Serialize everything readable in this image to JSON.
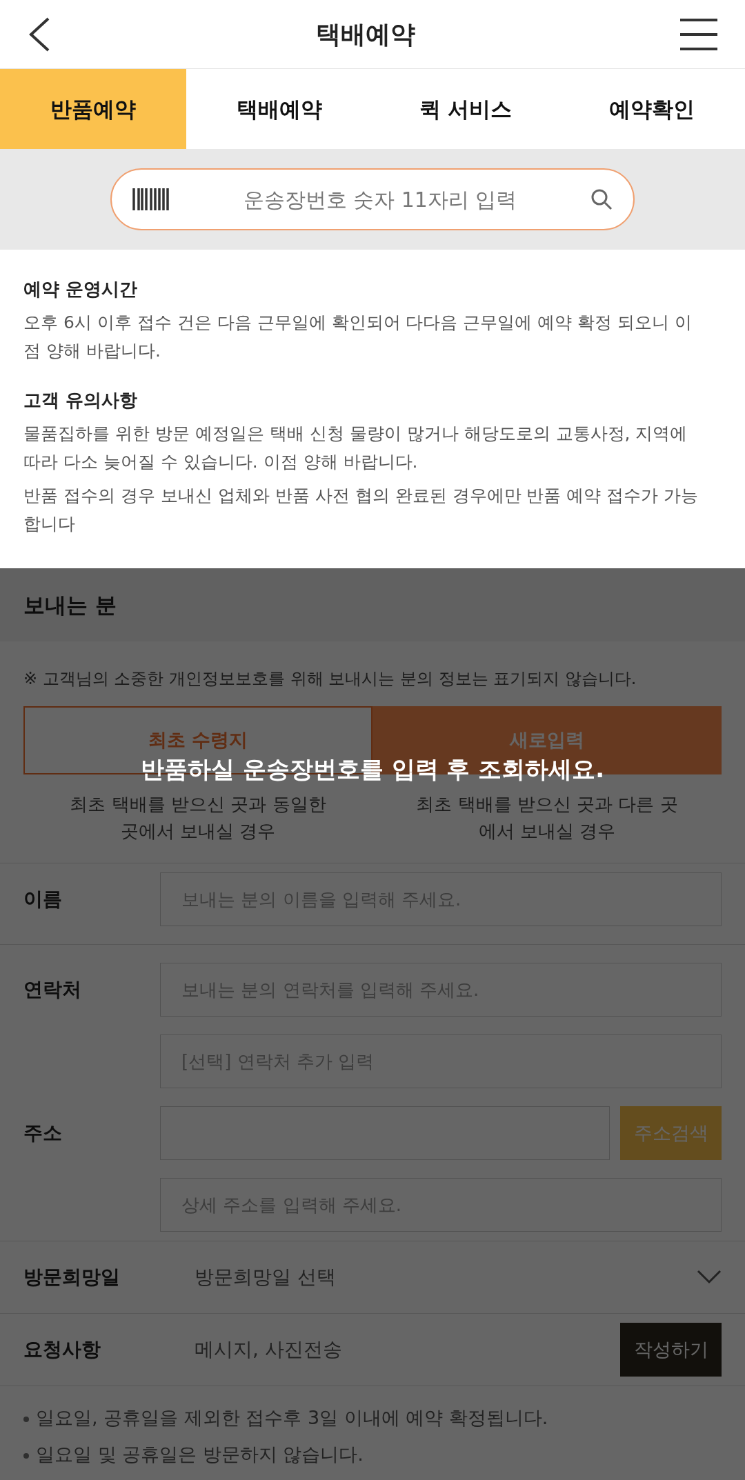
{
  "header": {
    "title": "택배예약"
  },
  "tabs": [
    {
      "label": "반품예약",
      "selected": true
    },
    {
      "label": "택배예약",
      "selected": false
    },
    {
      "label": "퀵 서비스",
      "selected": false
    },
    {
      "label": "예약확인",
      "selected": false
    }
  ],
  "search": {
    "placeholder": "운송장번호 숫자 11자리 입력"
  },
  "info": [
    {
      "title": "예약 운영시간",
      "paragraphs": [
        "오후 6시 이후 접수 건은 다음 근무일에 확인되어 다다음 근무일에 예약 확정 되오니 이점 양해 바랍니다."
      ]
    },
    {
      "title": "고객 유의사항",
      "paragraphs": [
        "물품집하를 위한 방문 예정일은 택배 신청 물량이 많거나 해당도로의 교통사정, 지역에 따라 다소 늦어질 수 있습니다. 이점 양해 바랍니다.",
        "반품 접수의 경우 보내신 업체와 반품 사전 협의 완료된 경우에만 반품 예약 접수가 가능합니다"
      ]
    }
  ],
  "sender": {
    "title": "보내는 분",
    "notice": "※ 고객님의 소중한 개인정보보호를 위해 보내시는 분의 정보는 표기되지 않습니다.",
    "options": [
      {
        "label": "최초 수령지",
        "caption": "최초 택배를 받으신 곳과 동일한 곳에서 보내실 경우",
        "selected": false
      },
      {
        "label": "새로입력",
        "caption": "최초 택배를 받으신 곳과 다른 곳에서 보내실 경우",
        "selected": true
      }
    ],
    "name": {
      "label": "이름",
      "placeholder": "보내는 분의 이름을 입력해 주세요."
    },
    "contact": {
      "label": "연락처",
      "placeholder": "보내는 분의 연락처를 입력해 주세요.",
      "extra_placeholder": "[선택] 연락처 추가 입력"
    },
    "address": {
      "label": "주소",
      "button": "주소검색",
      "detail_placeholder": "상세 주소를 입력해 주세요."
    },
    "visit_date": {
      "label": "방문희망일",
      "value": "방문희망일 선택"
    },
    "request": {
      "label": "요청사항",
      "value": "메시지, 사진전송",
      "button": "작성하기"
    },
    "notes": [
      "일요일, 공휴일을 제외한 접수후 3일 이내에 예약 확정됩니다.",
      "일요일 및 공휴일은 방문하지 않습니다."
    ]
  },
  "overlay": {
    "visible": true,
    "message": "반품하실 운송장번호를 입력 후 조회하세요."
  }
}
